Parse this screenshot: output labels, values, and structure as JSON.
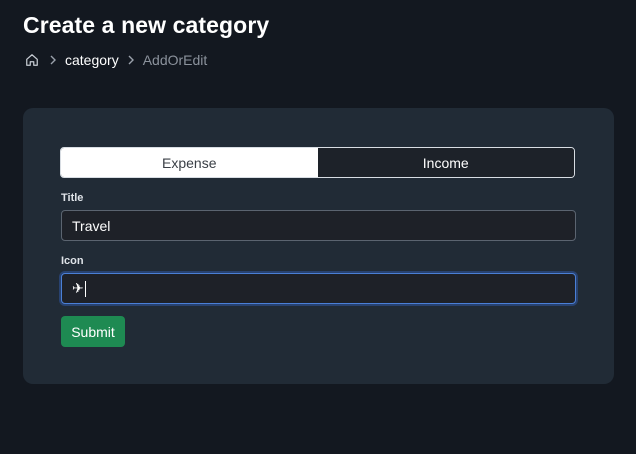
{
  "header": {
    "title": "Create a new category"
  },
  "breadcrumb": {
    "home_icon": "home-icon",
    "items": [
      {
        "label": "category"
      },
      {
        "label": "AddOrEdit"
      }
    ]
  },
  "form": {
    "type_toggle": {
      "options": [
        {
          "label": "Expense",
          "selected": false
        },
        {
          "label": "Income",
          "selected": true
        }
      ]
    },
    "title_field": {
      "label": "Title",
      "value": "Travel"
    },
    "icon_field": {
      "label": "Icon",
      "value": "✈"
    },
    "submit_label": "Submit"
  },
  "colors": {
    "background": "#131820",
    "card": "#212b36",
    "submit": "#1e8a52",
    "focus_ring": "#4a7fd6"
  }
}
